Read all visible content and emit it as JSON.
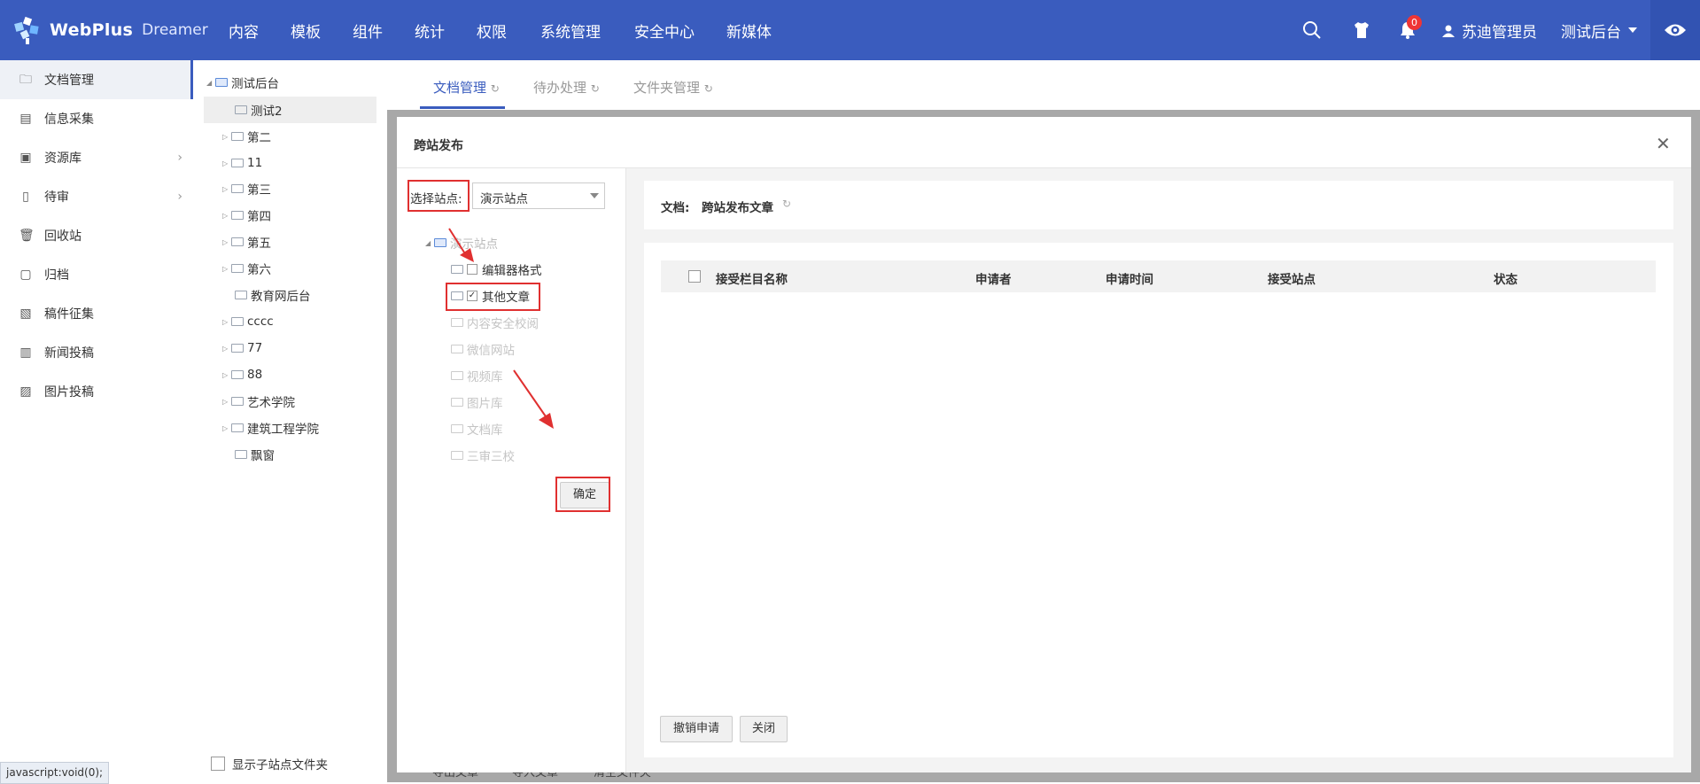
{
  "app": {
    "logo_text": "WebPlus",
    "logo_sub": "Dreamer"
  },
  "nav": [
    "内容",
    "模板",
    "组件",
    "统计",
    "权限",
    "系统管理",
    "安全中心",
    "新媒体"
  ],
  "header": {
    "notif_count": "0",
    "user_name": "苏迪管理员",
    "site_name": "测试后台",
    "accent": "#3a5cbe"
  },
  "sidebar": {
    "items": [
      {
        "label": "文档管理",
        "icon": "folder-icon"
      },
      {
        "label": "信息采集",
        "icon": "clipboard-icon"
      },
      {
        "label": "资源库",
        "icon": "box-icon"
      },
      {
        "label": "待审",
        "icon": "pending-doc-icon"
      },
      {
        "label": "回收站",
        "icon": "trash-icon"
      },
      {
        "label": "归档",
        "icon": "archive-icon"
      },
      {
        "label": "稿件征集",
        "icon": "collect-icon"
      },
      {
        "label": "新闻投稿",
        "icon": "news-icon"
      },
      {
        "label": "图片投稿",
        "icon": "image-icon"
      }
    ]
  },
  "tree": {
    "root": "测试后台",
    "nodes": [
      "测试2",
      "第二",
      "11",
      "第三",
      "第四",
      "第五",
      "第六",
      "教育网后台",
      "cccc",
      "77",
      "88",
      "艺术学院",
      "建筑工程学院",
      "飘窗"
    ],
    "show_sub_label": "显示子站点文件夹"
  },
  "tabs": [
    "文档管理",
    "待办处理",
    "文件夹管理"
  ],
  "modal": {
    "title": "跨站发布",
    "select_label": "选择站点:",
    "select_value": "演示站点",
    "site_tree_root": "演示站点",
    "site_nodes": [
      "编辑器格式",
      "其他文章",
      "内容安全校阅",
      "微信网站",
      "视频库",
      "图片库",
      "文档库",
      "三审三校"
    ],
    "confirm": "确定",
    "doc_label": "文档:",
    "doc_title": "跨站发布文章",
    "columns": [
      "接受栏目名称",
      "申请者",
      "申请时间",
      "接受站点",
      "状态"
    ],
    "btn_cancel_apply": "撤销申请",
    "btn_close": "关闭"
  },
  "behind_buttons": [
    "导出文章",
    "导入文章",
    "清空文件夹"
  ],
  "statusbar": "javascript:void(0);"
}
